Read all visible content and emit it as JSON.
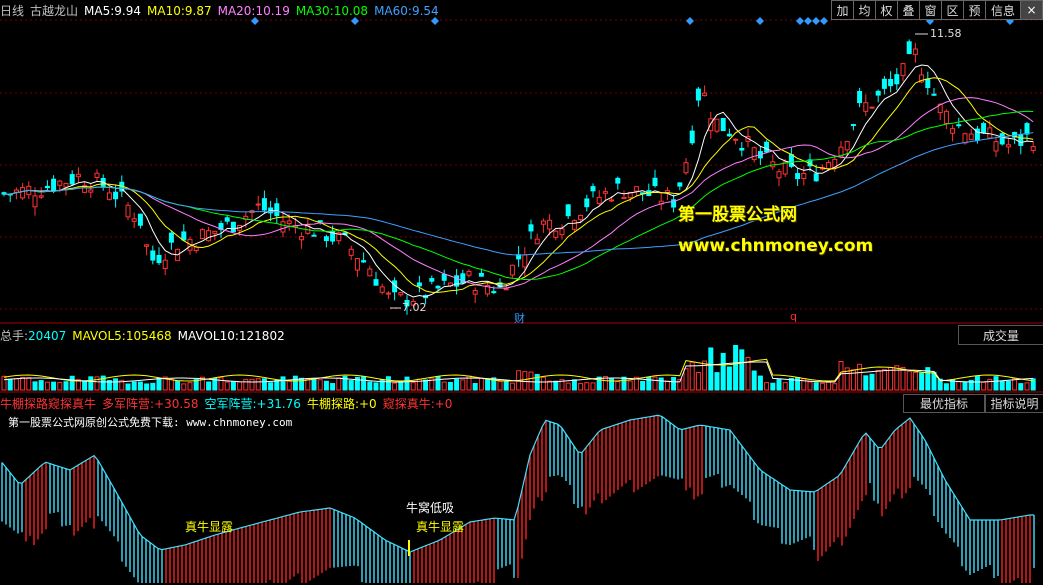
{
  "toolbar": {
    "buttons": [
      "加",
      "均",
      "权",
      "叠",
      "窗",
      "区",
      "预",
      "信息"
    ],
    "close": "×"
  },
  "colors": {
    "up": "#ff3232",
    "down": "#00ffff",
    "ma5": "#ffffff",
    "ma10": "#ffff00",
    "ma20": "#ff80ff",
    "ma30": "#00ff00",
    "ma60": "#40a0ff",
    "grid": "#7a0000",
    "marker": "#3399ff",
    "osc_up": "#ff2020",
    "osc_down": "#40e0ff"
  },
  "main_panel": {
    "period": "日线",
    "name": "古越龙山",
    "ma5_label": "MA5:",
    "ma5": "9.94",
    "ma10_label": "MA10:",
    "ma10": "9.87",
    "ma20_label": "MA20:",
    "ma20": "10.19",
    "ma30_label": "MA30:",
    "ma30": "10.08",
    "ma60_label": "MA60:",
    "ma60": "9.54",
    "high_label": "11.58",
    "low_label": "7.02",
    "event_cai": "财",
    "event_q": "q",
    "watermark1": "第一股票公式网",
    "watermark2": "www.chnmoney.com"
  },
  "volume_panel": {
    "total_label": "总手:",
    "total": "20407",
    "mavol5_label": "MAVOL5:",
    "mavol5": "105468",
    "mavol10_label": "MAVOL10:",
    "mavol10": "121802",
    "dropdown": "成交量"
  },
  "osc_panel": {
    "title": "牛棚探路窥探真牛",
    "duo_label": "多军阵营:",
    "duo": "+30.58",
    "kong_label": "空军阵营:",
    "kong": "+31.76",
    "tanlu_label": "牛棚探路:",
    "tanlu": "+0",
    "kuitan_label": "窥探真牛:",
    "kuitan": "+0",
    "subtitle": "第一股票公式网原创公式免费下载: www.chnmoney.com",
    "btn_best": "最优指标",
    "btn_help": "指标说明",
    "ann1": "真牛显露",
    "ann2": "牛窝低吸",
    "ann3": "真牛显露"
  },
  "chart_data": {
    "type": "candlestick",
    "high": 11.58,
    "low": 7.02,
    "ma_last": {
      "MA5": 9.94,
      "MA10": 9.87,
      "MA20": 10.19,
      "MA30": 10.08,
      "MA60": 9.54
    }
  }
}
